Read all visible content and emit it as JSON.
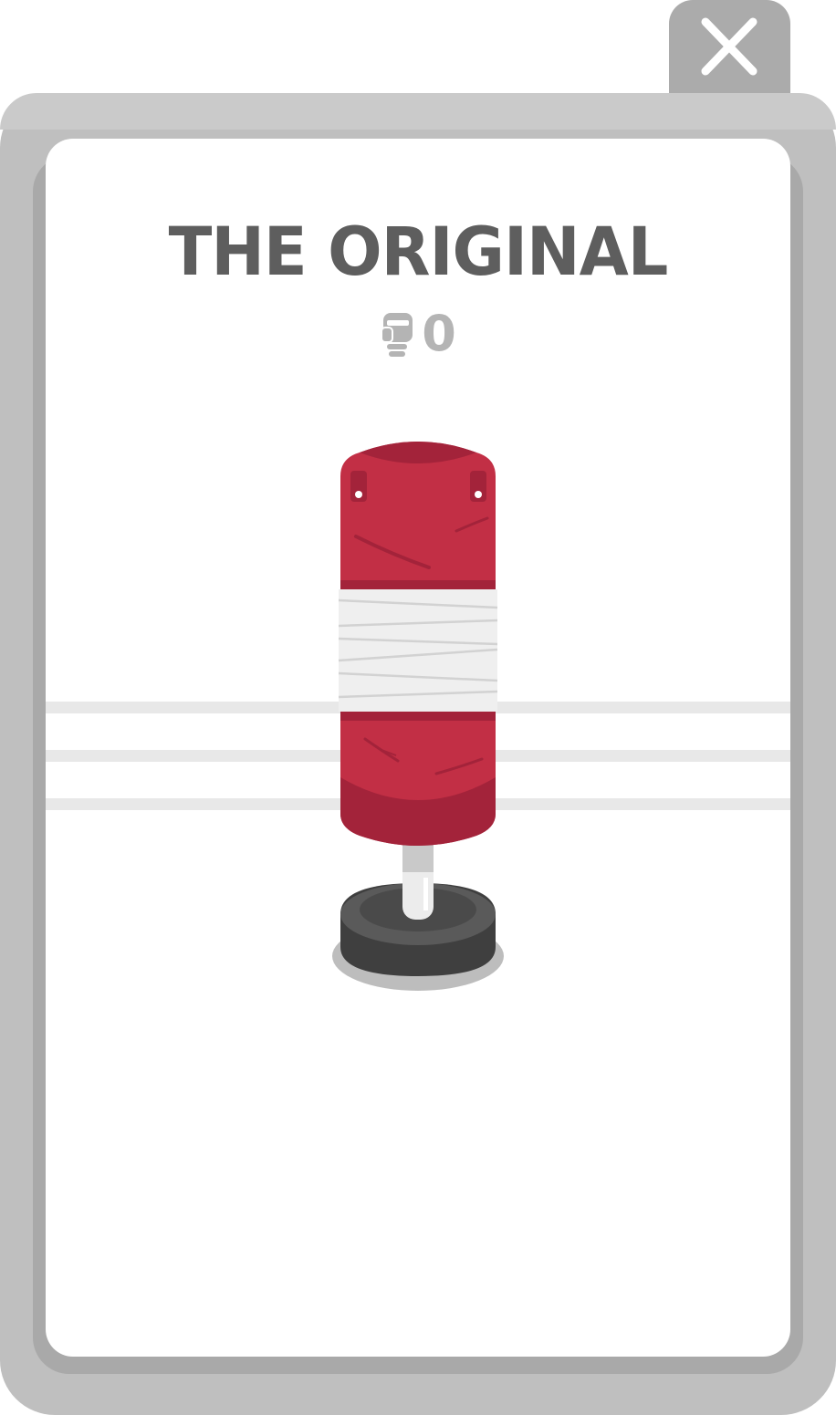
{
  "dialog": {
    "title": "THE ORIGINAL",
    "punch_count": "0",
    "count_icon": "boxing-glove-icon",
    "close_icon": "close-icon",
    "item_image": "punching-bag"
  },
  "colors": {
    "frame": "#bfbfbf",
    "frame_inner": "#a9a9a9",
    "title": "#5e5e5e",
    "count": "#b4b4b4",
    "bag_red": "#c22f45",
    "bag_dark_red": "#a3233a",
    "tape": "#efefef",
    "base": "#4a4a4a"
  }
}
